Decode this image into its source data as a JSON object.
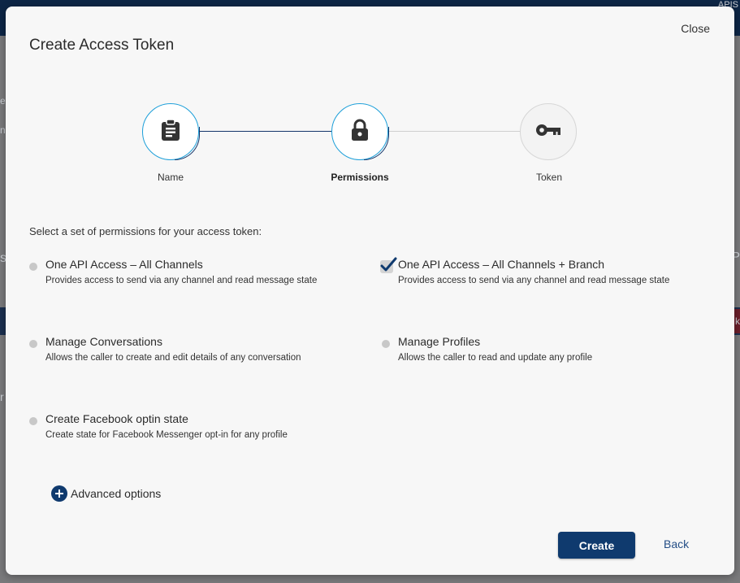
{
  "background": {
    "top_right_text": "APIS",
    "side_fragments": [
      "e",
      "n",
      "s",
      "P",
      "k",
      "r"
    ]
  },
  "modal": {
    "title": "Create Access Token",
    "close_label": "Close"
  },
  "stepper": {
    "steps": [
      {
        "label": "Name",
        "icon": "clipboard-icon",
        "state": "completed"
      },
      {
        "label": "Permissions",
        "icon": "lock-icon",
        "state": "active"
      },
      {
        "label": "Token",
        "icon": "key-icon",
        "state": "pending"
      }
    ]
  },
  "permissions": {
    "prompt": "Select a set of permissions for your access token:",
    "options": [
      {
        "title": "One API Access – All Channels",
        "description": "Provides access to send via any channel and read message state",
        "selected": false
      },
      {
        "title": "One API Access – All Channels + Branch",
        "description": "Provides access to send via any channel and read message state",
        "selected": true
      },
      {
        "title": "Manage Conversations",
        "description": "Allows the caller to create and edit details of any conversation",
        "selected": false
      },
      {
        "title": "Manage Profiles",
        "description": "Allows the caller to read and update any profile",
        "selected": false
      },
      {
        "title": "Create Facebook optin state",
        "description": "Create state for Facebook Messenger opt-in for any profile",
        "selected": false
      }
    ]
  },
  "advanced_options_label": "Advanced options",
  "actions": {
    "create_label": "Create",
    "back_label": "Back"
  },
  "colors": {
    "primary": "#0f3a6e",
    "step_ring": "#1c9fd9",
    "link": "#244e86",
    "modal_bg": "#f7f7f7"
  }
}
